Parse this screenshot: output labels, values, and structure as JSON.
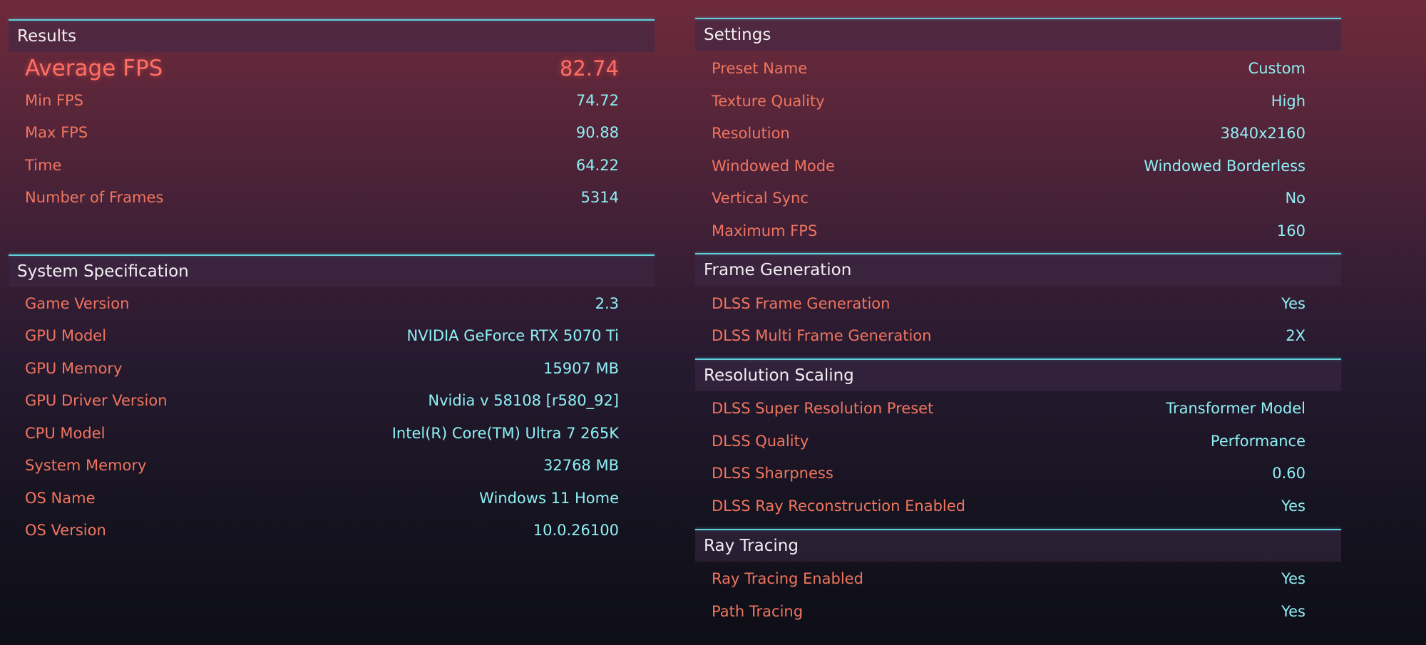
{
  "results": {
    "title": "Results",
    "average": {
      "label": "Average FPS",
      "value": "82.74"
    },
    "rows": [
      {
        "label": "Min FPS",
        "value": "74.72"
      },
      {
        "label": "Max FPS",
        "value": "90.88"
      },
      {
        "label": "Time",
        "value": "64.22"
      },
      {
        "label": "Number of Frames",
        "value": "5314"
      }
    ]
  },
  "system": {
    "title": "System Specification",
    "rows": [
      {
        "label": "Game Version",
        "value": "2.3"
      },
      {
        "label": "GPU Model",
        "value": "NVIDIA GeForce RTX 5070 Ti"
      },
      {
        "label": "GPU Memory",
        "value": "15907 MB"
      },
      {
        "label": "GPU Driver Version",
        "value": "Nvidia v 58108 [r580_92]"
      },
      {
        "label": "CPU Model",
        "value": "Intel(R) Core(TM) Ultra 7 265K"
      },
      {
        "label": "System Memory",
        "value": "32768 MB"
      },
      {
        "label": "OS Name",
        "value": "Windows 11 Home"
      },
      {
        "label": "OS Version",
        "value": "10.0.26100"
      }
    ]
  },
  "settings": {
    "title": "Settings",
    "rows": [
      {
        "label": "Preset Name",
        "value": "Custom"
      },
      {
        "label": "Texture Quality",
        "value": "High"
      },
      {
        "label": "Resolution",
        "value": "3840x2160"
      },
      {
        "label": "Windowed Mode",
        "value": "Windowed Borderless"
      },
      {
        "label": "Vertical Sync",
        "value": "No"
      },
      {
        "label": "Maximum FPS",
        "value": "160"
      }
    ]
  },
  "frame_generation": {
    "title": "Frame Generation",
    "rows": [
      {
        "label": "DLSS Frame Generation",
        "value": "Yes"
      },
      {
        "label": "DLSS Multi Frame Generation",
        "value": "2X"
      }
    ]
  },
  "resolution_scaling": {
    "title": "Resolution Scaling",
    "rows": [
      {
        "label": "DLSS Super Resolution Preset",
        "value": "Transformer Model"
      },
      {
        "label": "DLSS Quality",
        "value": "Performance"
      },
      {
        "label": "DLSS Sharpness",
        "value": "0.60"
      },
      {
        "label": "DLSS Ray Reconstruction Enabled",
        "value": "Yes"
      }
    ]
  },
  "ray_tracing": {
    "title": "Ray Tracing",
    "rows": [
      {
        "label": "Ray Tracing Enabled",
        "value": "Yes"
      },
      {
        "label": "Path Tracing",
        "value": "Yes"
      }
    ]
  }
}
